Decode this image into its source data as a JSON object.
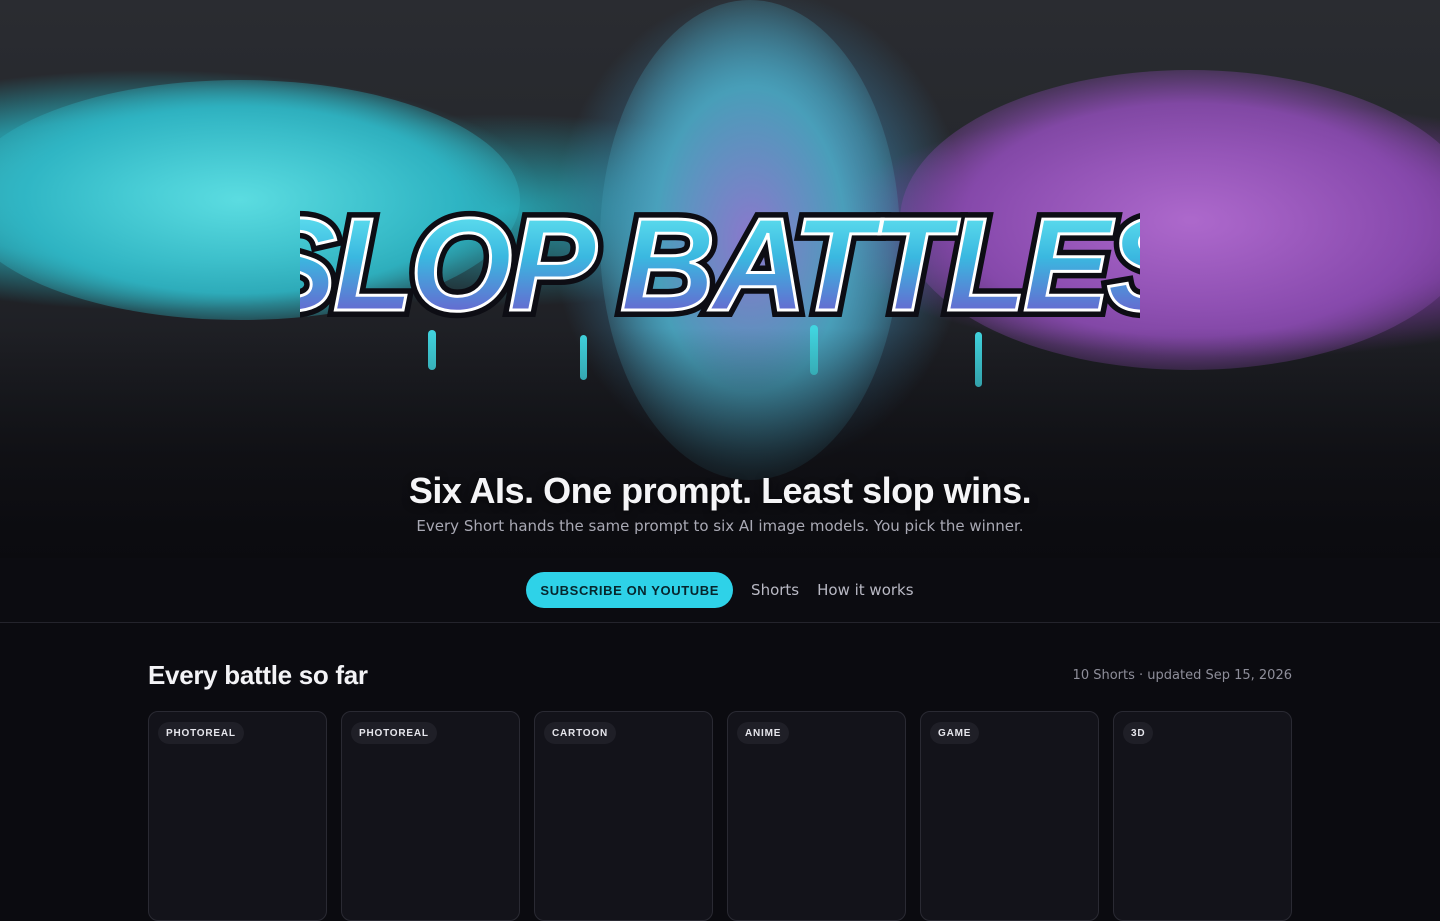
{
  "hero": {
    "logo_text": "SLOP BATTLES",
    "title": "Six AIs. One prompt. Least slop wins.",
    "subtitle": "Every Short hands the same prompt to six AI image models. You pick the winner."
  },
  "nav": {
    "subscribe_label": "SUBSCRIBE ON YOUTUBE",
    "links": [
      {
        "label": "Shorts"
      },
      {
        "label": "How it works"
      }
    ]
  },
  "main": {
    "section_title": "Every battle so far",
    "section_meta": "10 Shorts · updated Sep 15, 2026",
    "cards": [
      {
        "tag": "PHOTOREAL"
      },
      {
        "tag": "PHOTOREAL"
      },
      {
        "tag": "CARTOON"
      },
      {
        "tag": "ANIME"
      },
      {
        "tag": "GAME"
      },
      {
        "tag": "3D"
      }
    ]
  },
  "colors": {
    "accent": "#2ed2e8",
    "background": "#0b0b10",
    "cyan_paint": "#46d7dc",
    "purple_paint": "#a050be"
  }
}
